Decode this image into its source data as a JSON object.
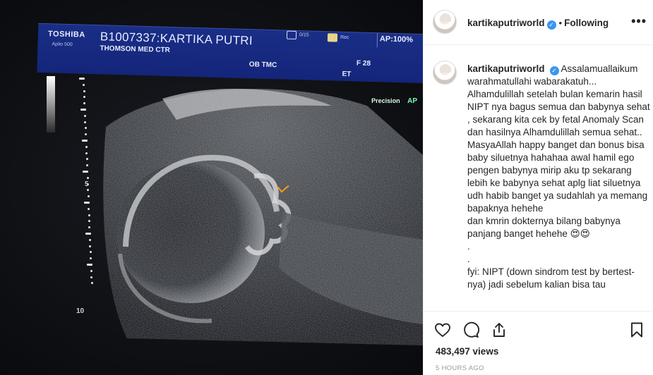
{
  "media": {
    "screen": {
      "brand": "TOSHIBA",
      "model": "Aplio 500",
      "patient_id": "B1007337:KARTIKA PUTRI",
      "hospital": "THOMSON MED CTR",
      "mode": "OB TMC",
      "frame_count": "0/15",
      "rec": "Rec",
      "ap": "AP:100%",
      "freq": "F 28",
      "et": "ET",
      "precision": "Precision",
      "ap_short": "AP",
      "depth_5": "5",
      "depth_10": "10"
    }
  },
  "post": {
    "username": "kartikaputriworld",
    "verified_glyph": "✓",
    "follow_status": "Following",
    "more_label": "•••",
    "caption": "Assalamuallaikum warahmatullahi wabarakatuh...\nAlhamdulillah setelah bulan kemarin hasil NIPT nya bagus semua dan babynya sehat , sekarang kita cek by fetal Anomaly Scan dan hasilnya Alhamdulillah semua sehat..\nMasyaAllah happy banget dan bonus bisa baby siluetnya hahahaa awal hamil ego pengen babynya mirip aku tp sekarang lebih ke babynya sehat aplg liat siluetnya udh habib banget ya sudahlah ya memang bapaknya hehehe\ndan kmrin dokternya bilang babynya panjang banget hehehe 😍😍\n.\n.\nfyi: NIPT (down sindrom test by bertest-nya) jadi sebelum kalian bisa tau"
  },
  "actions": {
    "like_icon": "heart-icon",
    "comment_icon": "speech-bubble-icon",
    "share_icon": "share-icon",
    "save_icon": "bookmark-icon",
    "views": "483,497 views",
    "time": "5 HOURS AGO"
  }
}
